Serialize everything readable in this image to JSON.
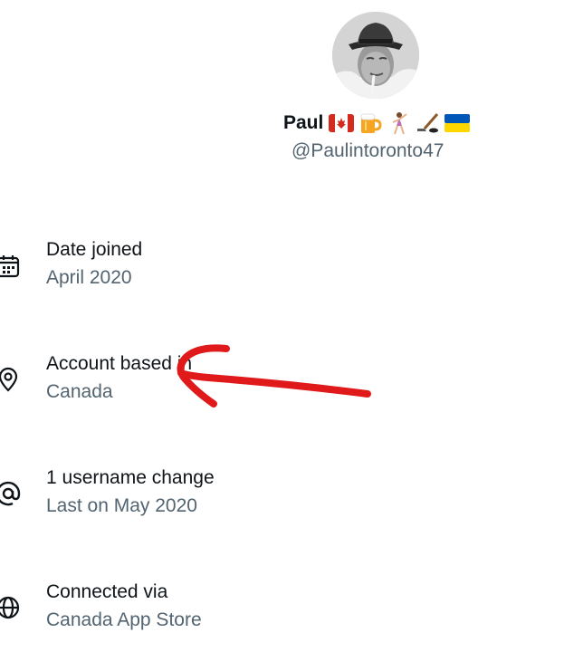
{
  "profile": {
    "display_name": "Paul",
    "handle": "@Paulintoronto47",
    "name_emojis": [
      "canada-flag-emoji",
      "beer-mug-emoji",
      "dancing-person-emoji",
      "hockey-stick-puck-emoji",
      "ukraine-flag-emoji"
    ]
  },
  "details": [
    {
      "title": "Date joined",
      "value": "April 2020",
      "icon": "calendar-icon"
    },
    {
      "title": "Account based in",
      "value": "Canada",
      "icon": "location-pin-icon"
    },
    {
      "title": "1 username change",
      "value": "Last on May 2020",
      "icon": "at-sign-icon"
    },
    {
      "title": "Connected via",
      "value": "Canada App Store",
      "icon": "globe-icon"
    }
  ],
  "colors": {
    "primary_text": "#0f1419",
    "secondary_text": "#536471",
    "annotation": "#e0191b"
  }
}
